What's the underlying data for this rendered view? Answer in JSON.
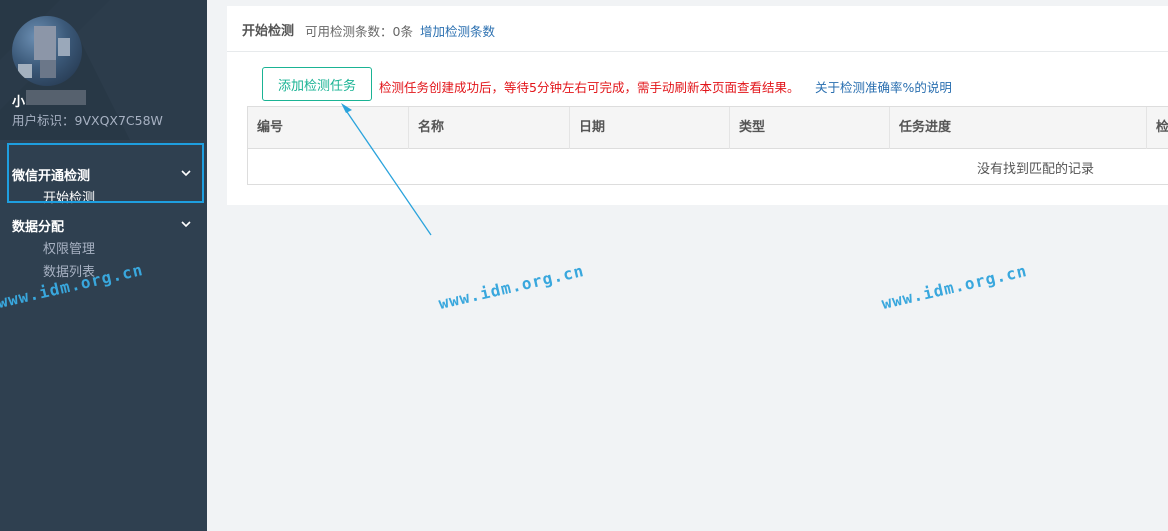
{
  "sidebar": {
    "user_name": "小",
    "user_id": "用户标识：9VXQX7C58W",
    "groups": [
      {
        "label": "微信开通检测",
        "items": [
          {
            "label": "开始检测"
          }
        ]
      },
      {
        "label": "数据分配",
        "items": [
          {
            "label": "权限管理"
          },
          {
            "label": "数据列表"
          }
        ]
      }
    ],
    "watermark": "www.idm.org.cn"
  },
  "header": {
    "title": "开始检测",
    "count_text": "可用检测条数：0条",
    "add_link": "增加检测条数"
  },
  "toolbar": {
    "add_button": "添加检测任务",
    "notice": "检测任务创建成功后，等待5分钟左右可完成，需手动刷新本页面查看结果。",
    "accuracy_link": "关于检测准确率%的说明"
  },
  "table": {
    "columns": [
      "编号",
      "名称",
      "日期",
      "类型",
      "任务进度",
      "检"
    ],
    "empty_text": "没有找到匹配的记录"
  },
  "watermarks": [
    "www.idm.org.cn",
    "www.idm.org.cn"
  ],
  "colors": {
    "sidebar_bg": "#2f4050",
    "accent_green": "#1ab394",
    "notice_red": "#e2151a",
    "link_blue": "#2a6fb0",
    "highlight_blue": "#1e9fe0"
  }
}
